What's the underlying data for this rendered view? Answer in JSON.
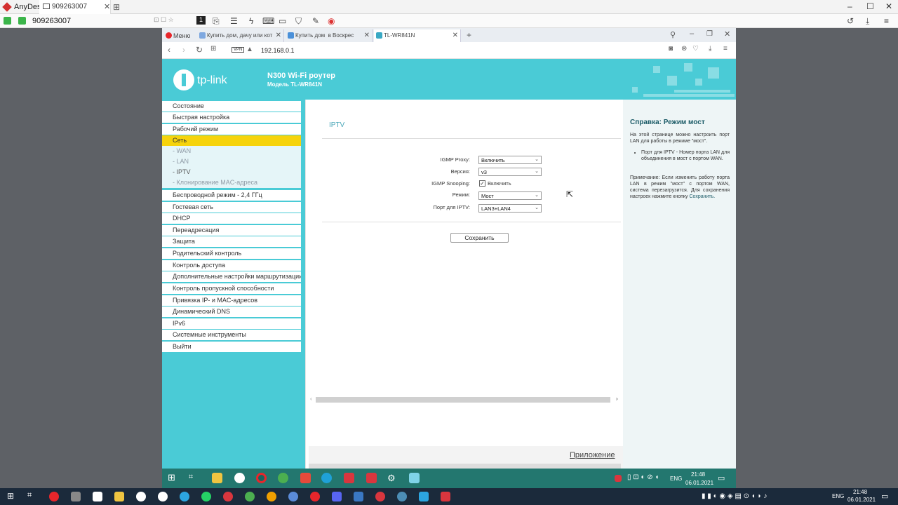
{
  "anydesk": {
    "app_name": "AnyDesk",
    "tab_label": "909263007",
    "address_id": "909263007",
    "window_controls": [
      "–",
      "☐",
      "✕"
    ],
    "toolbar_icons": [
      "keyboard-icon",
      "file-transfer-icon",
      "chat-icon",
      "lightning-icon",
      "keyboard-layout-icon",
      "display-icon",
      "shield-icon",
      "pen-icon",
      "record-icon"
    ],
    "right_icons": [
      "history-icon",
      "download-icon",
      "menu-icon"
    ]
  },
  "browser": {
    "tabs": [
      {
        "label": "Меню",
        "color": "#e8262b"
      },
      {
        "label": "Купить дом, дачу или кот",
        "color": "#7ea8e0"
      },
      {
        "label": "Купить дом  в Воскрес",
        "color": "#4a90d9"
      },
      {
        "label": "TL-WR841N",
        "color": "#3aa9c4"
      }
    ],
    "new_tab": "+",
    "vpn_label": "VPN",
    "url": "192.168.0.1"
  },
  "router": {
    "brand": "tp-link",
    "model_title": "N300 Wi-Fi роутер",
    "model_sub": "Модель TL-WR841N",
    "menu": [
      {
        "label": "Состояние",
        "type": "item"
      },
      {
        "label": "Быстрая настройка",
        "type": "item"
      },
      {
        "label": "Рабочий режим",
        "type": "item"
      },
      {
        "label": "Сеть",
        "type": "selected"
      },
      {
        "label": "- WAN",
        "type": "sub"
      },
      {
        "label": "- LAN",
        "type": "sub"
      },
      {
        "label": "- IPTV",
        "type": "sub"
      },
      {
        "label": "- Клонирование MAC-адреса",
        "type": "sub"
      },
      {
        "label": "Беспроводной режим - 2,4 ГГц",
        "type": "item"
      },
      {
        "label": "Гостевая сеть",
        "type": "item"
      },
      {
        "label": "DHCP",
        "type": "item"
      },
      {
        "label": "Переадресация",
        "type": "item"
      },
      {
        "label": "Защита",
        "type": "item"
      },
      {
        "label": "Родительский контроль",
        "type": "item"
      },
      {
        "label": "Контроль доступа",
        "type": "item"
      },
      {
        "label": "Дополнительные настройки маршрутизации",
        "type": "item"
      },
      {
        "label": "Контроль пропускной способности",
        "type": "item"
      },
      {
        "label": "Привязка IP- и MAC-адресов",
        "type": "item"
      },
      {
        "label": "Динамический DNS",
        "type": "item"
      },
      {
        "label": "IPv6",
        "type": "item"
      },
      {
        "label": "Системные инструменты",
        "type": "item"
      },
      {
        "label": "Выйти",
        "type": "item"
      }
    ],
    "iptv": {
      "title": "IPTV",
      "igmp_proxy_label": "IGMP Proxy:",
      "igmp_proxy_value": "Включить",
      "version_label": "Версия:",
      "version_value": "v3",
      "snooping_label": "IGMP Snooping:",
      "snooping_checked": true,
      "snooping_text": "Включить",
      "mode_label": "Режим:",
      "mode_value": "Мост",
      "port_label": "Порт для IPTV:",
      "port_value": "LAN3+LAN4",
      "save_label": "Сохранить",
      "app_link": "Приложение"
    },
    "help": {
      "title": "Справка: Режим мост",
      "intro": "На этой странице можно настроить порт LAN для работы в режиме \"мост\".",
      "bullet": "Порт для IPTV - Номер порта LAN для объединения в мост с портом WAN.",
      "note": "Примечание: Если изменить работу порта LAN в режим \"мост\" с портом WAN, система перезагрузится. Для сохранения настроек нажмите кнопку",
      "note_link": "Сохранить."
    }
  },
  "remote_taskbar": {
    "lang": "ENG",
    "time": "21:48",
    "date": "06.01.2021"
  },
  "local_taskbar": {
    "lang": "ENG",
    "time": "21:48",
    "date": "06.01.2021"
  }
}
